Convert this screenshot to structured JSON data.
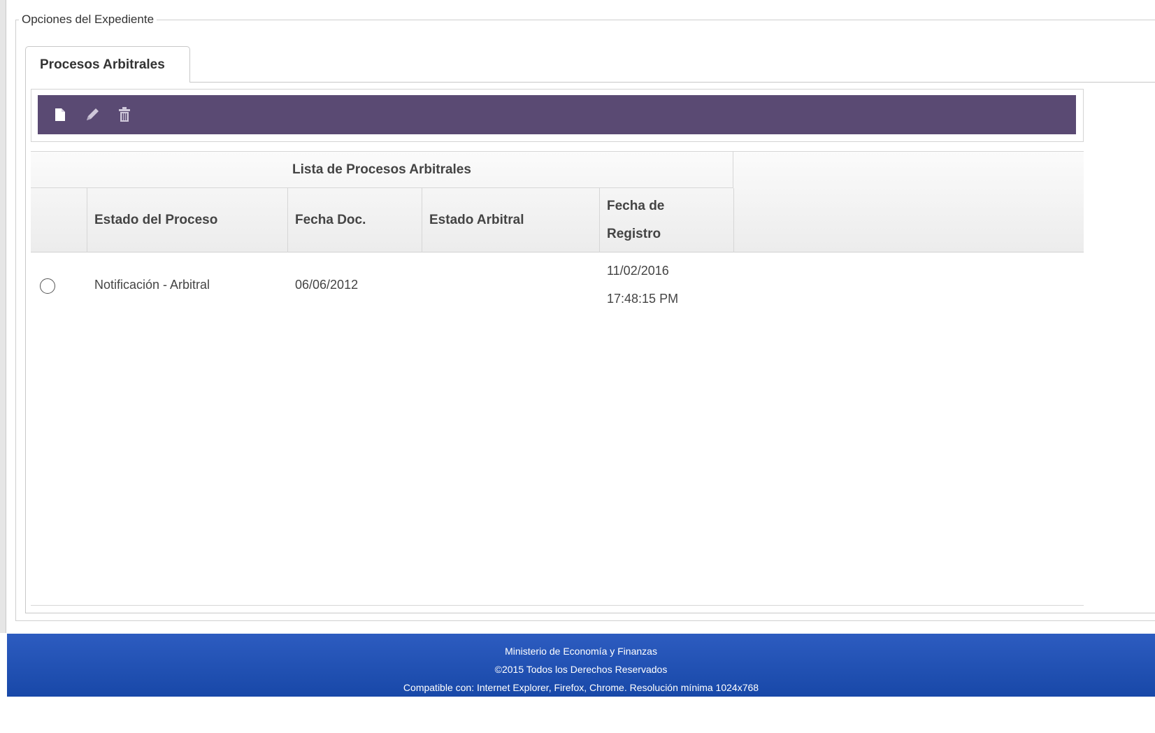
{
  "fieldset": {
    "legend": "Opciones del Expediente"
  },
  "tabs": [
    {
      "label": "Procesos Arbitrales"
    }
  ],
  "toolbar": {
    "buttons": [
      {
        "icon": "new-document-icon",
        "color": "#ffffff"
      },
      {
        "icon": "edit-pencil-icon",
        "color": "#cfc8da"
      },
      {
        "icon": "trash-icon",
        "color": "#cfc8da"
      }
    ],
    "background": "#5a4a73"
  },
  "table": {
    "group_title": "Lista de Procesos Arbitrales",
    "columns": [
      "Estado del Proceso",
      "Fecha Doc.",
      "Estado Arbitral",
      "Fecha de Registro"
    ],
    "column_lines": [
      [
        "Estado del Proceso"
      ],
      [
        "Fecha Doc."
      ],
      [
        "Estado Arbitral"
      ],
      [
        "Fecha de",
        "Registro"
      ]
    ],
    "rows": [
      {
        "selected": false,
        "estado_proceso": "Notificación - Arbitral",
        "fecha_doc": "06/06/2012",
        "estado_arbitral": "",
        "fecha_registro_date": "11/02/2016",
        "fecha_registro_time": "17:48:15 PM"
      }
    ]
  },
  "footer": {
    "line1": "Ministerio de Economía y Finanzas",
    "line2": "©2015 Todos los Derechos Reservados",
    "line3": "Compatible con: Internet Explorer, Firefox, Chrome. Resolución mínima 1024x768",
    "background": "#1f4fb0"
  }
}
